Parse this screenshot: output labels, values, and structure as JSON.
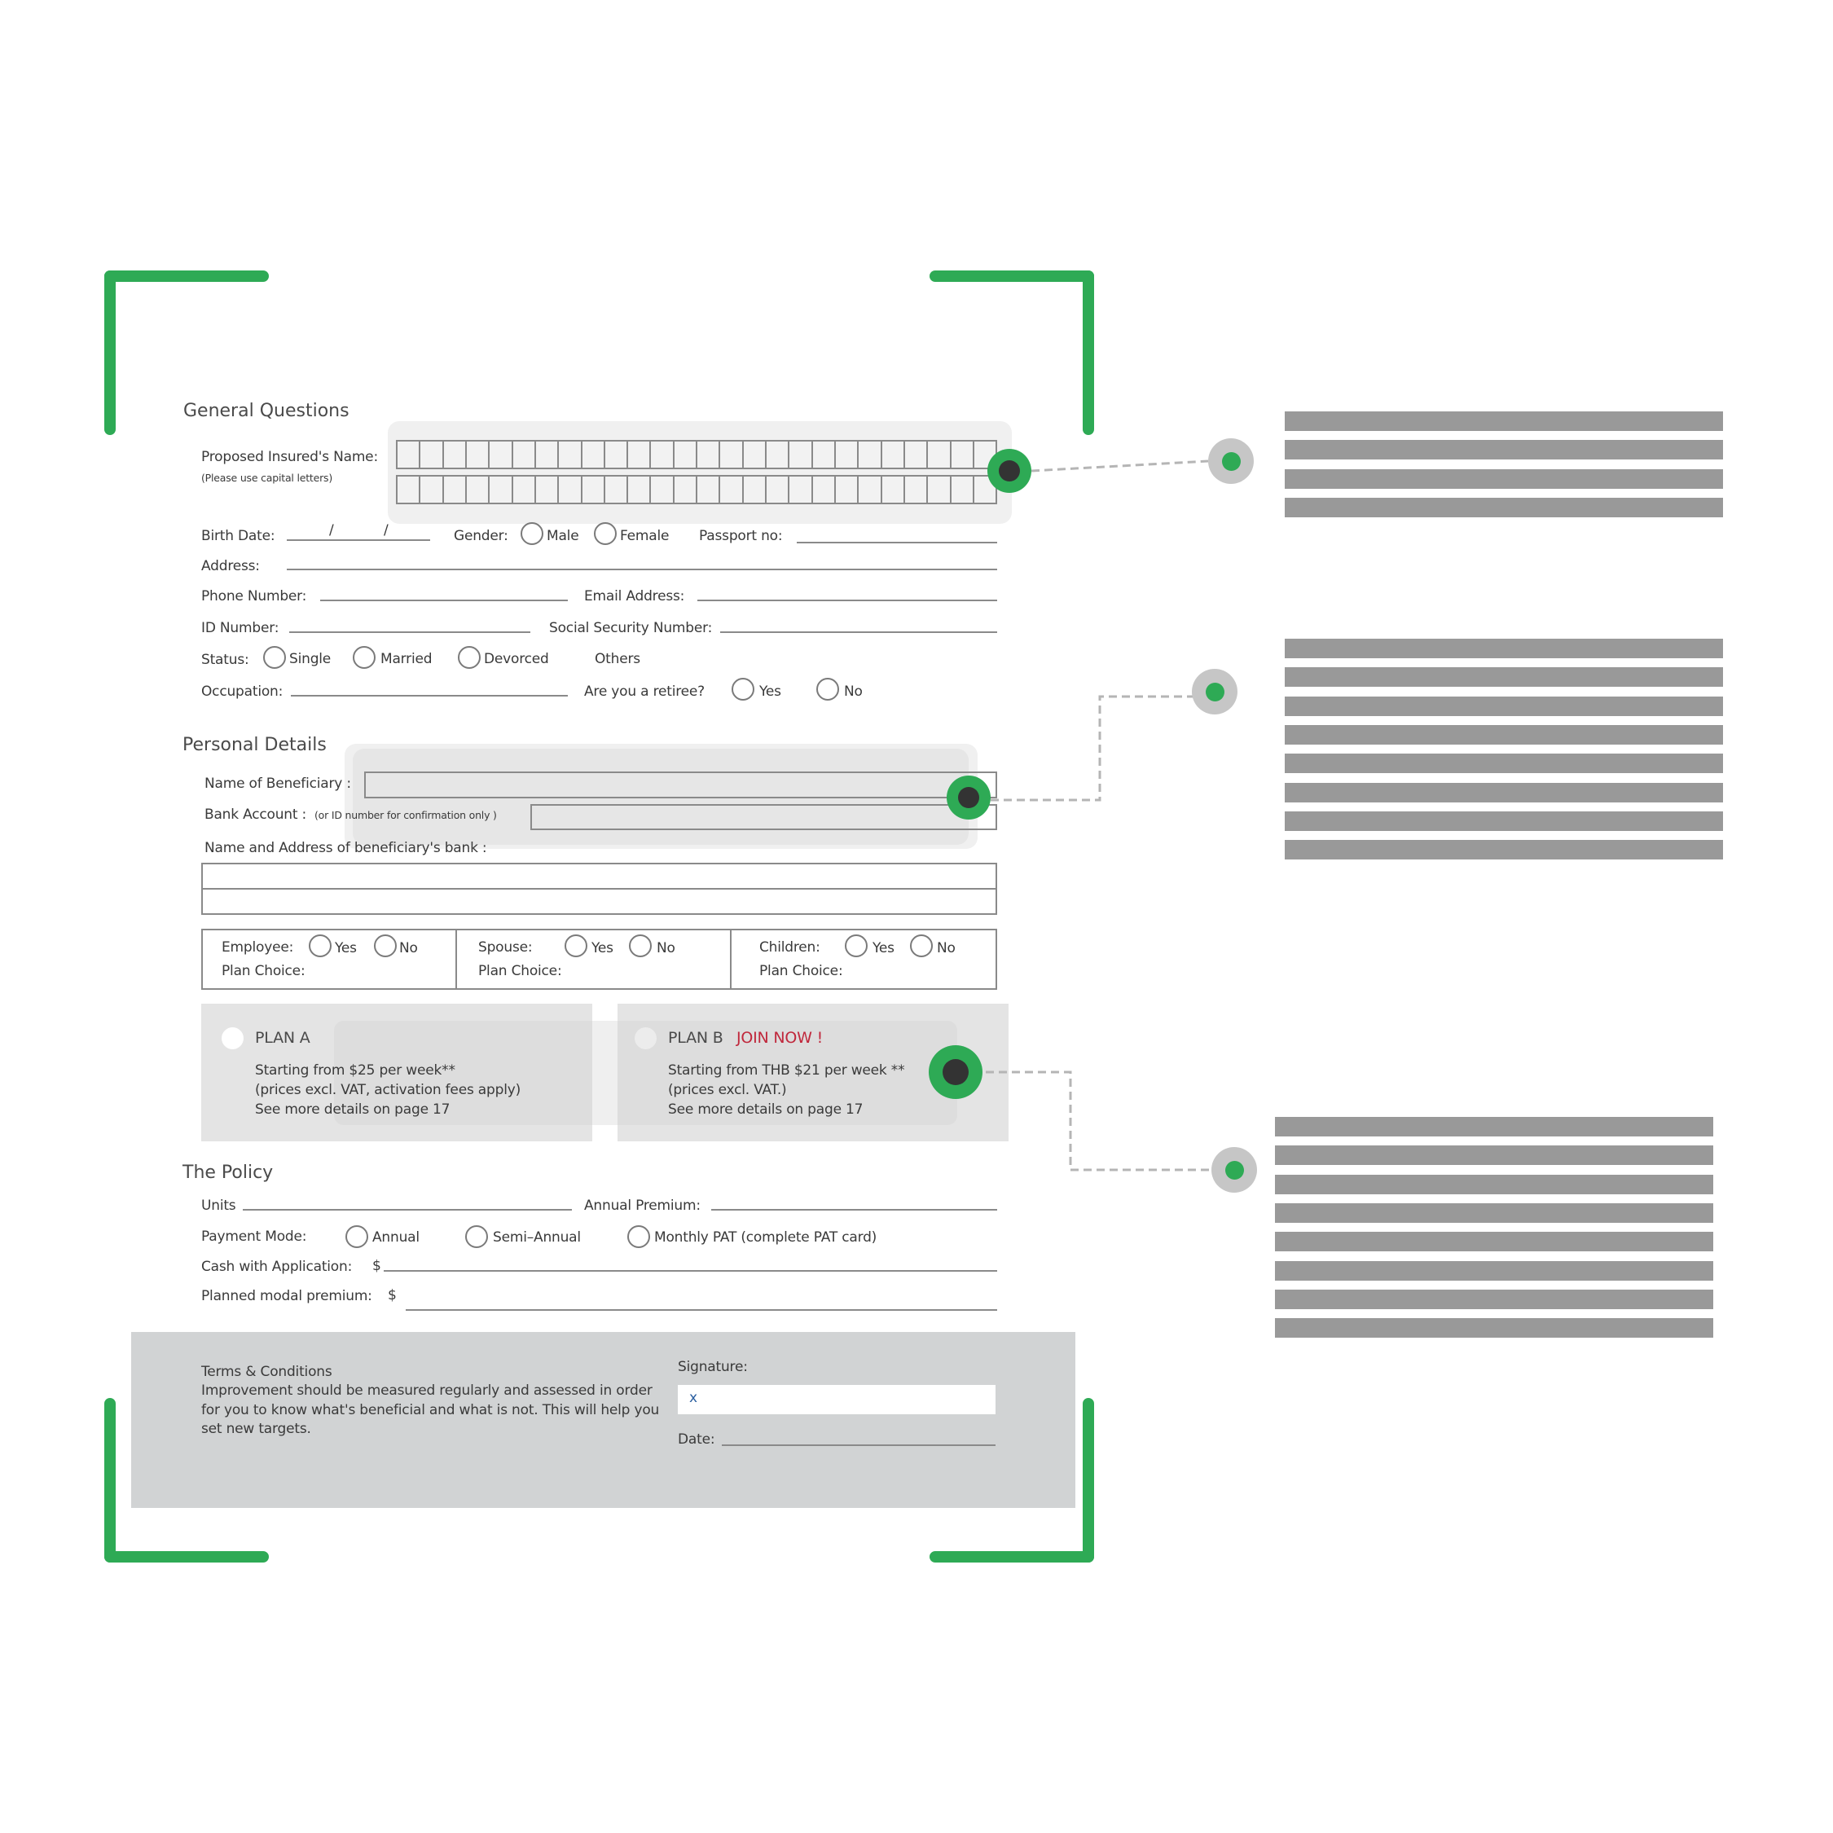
{
  "general": {
    "heading": "General Questions",
    "insured_name_label": "Proposed Insured's Name:",
    "insured_name_hint": "(Please use capital letters)",
    "name_grid_cells_per_row": 26,
    "name_grid_rows": 2,
    "birth_date_label": "Birth Date:",
    "birth_date_separators": [
      "/",
      "/"
    ],
    "gender_label": "Gender:",
    "gender_options": [
      "Male",
      "Female"
    ],
    "passport_label": "Passport no:",
    "address_label": "Address:",
    "phone_label": "Phone Number:",
    "email_label": "Email Address:",
    "id_label": "ID Number:",
    "ssn_label": "Social Security  Number:",
    "status_label": "Status:",
    "status_options": [
      "Single",
      "Married",
      "Devorced",
      "Others"
    ],
    "occupation_label": "Occupation:",
    "retiree_label": "Are you a retiree?",
    "retiree_options": [
      "Yes",
      "No"
    ]
  },
  "personal": {
    "heading": "Personal Details",
    "beneficiary_label": "Name of Beneficiary :",
    "bank_account_label": "Bank Account :",
    "bank_account_hint": "(or ID number for confirmation only )",
    "bank_address_label": "Name and Address of beneficiary's bank :",
    "coverage": [
      {
        "label": "Employee:",
        "options": [
          "Yes",
          "No"
        ],
        "plan_choice": "Plan Choice:"
      },
      {
        "label": "Spouse:",
        "options": [
          "Yes",
          "No"
        ],
        "plan_choice": "Plan Choice:"
      },
      {
        "label": "Children:",
        "options": [
          "Yes",
          "No"
        ],
        "plan_choice": "Plan Choice:"
      }
    ]
  },
  "plans": [
    {
      "title": "PLAN A",
      "badge": "",
      "lines": [
        "Starting from $25 per week**",
        "(prices excl. VAT, activation fees apply)",
        "See more details on page 17"
      ]
    },
    {
      "title": "PLAN B",
      "badge": "JOIN NOW !",
      "lines": [
        "Starting from THB $21 per week **",
        "(prices excl. VAT.)",
        "See more details on page 17"
      ]
    }
  ],
  "policy": {
    "heading": "The Policy",
    "units_label": "Units",
    "annual_premium_label": "Annual Premium:",
    "payment_mode_label": "Payment Mode:",
    "payment_options": [
      "Annual",
      "Semi–Annual",
      "Monthly PAT (complete PAT card)"
    ],
    "cash_label": "Cash with Application:",
    "cash_currency": "$",
    "planned_label": "Planned modal premium:",
    "planned_currency": "$"
  },
  "terms": {
    "title": "Terms & Conditions",
    "body_lines": [
      "Improvement should be measured regularly and assessed in order",
      "for you to know what's beneficial and what is not. This will help you",
      "set new targets."
    ],
    "signature_label": "Signature:",
    "signature_value": "x",
    "date_label": "Date:"
  },
  "callouts": [
    {
      "target": "insured-name",
      "placeholder_lines": 4
    },
    {
      "target": "beneficiary-bank",
      "placeholder_lines": 8
    },
    {
      "target": "plan-b",
      "placeholder_lines": 8
    }
  ],
  "colors": {
    "accent_green": "#2eaa55",
    "marker_core": "#333333",
    "node_ring": "#c6c6c6",
    "placeholder_bar": "#999999",
    "join_now_red": "#c0283c",
    "terms_panel": "#d1d3d4",
    "plan_panel": "#e4e4e4"
  }
}
